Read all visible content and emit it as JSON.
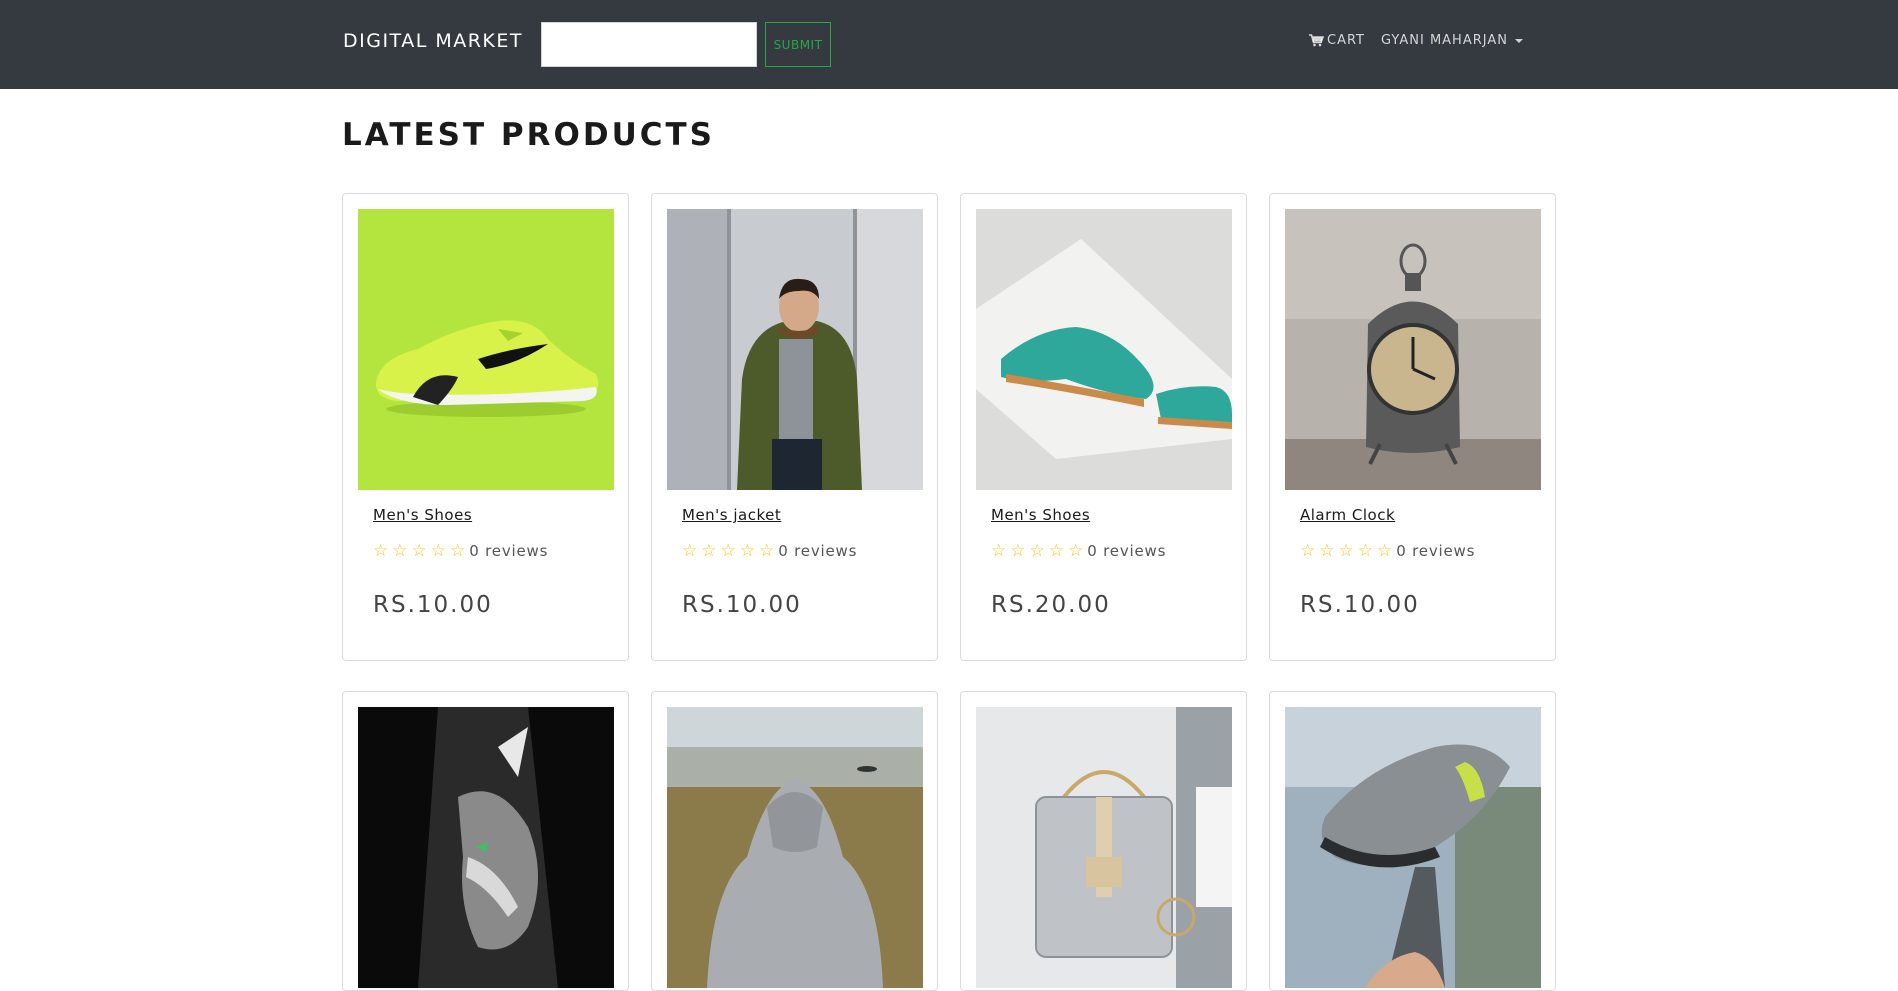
{
  "navbar": {
    "brand": "DIGITAL MARKET",
    "search_placeholder": "",
    "submit_label": "SUBMIT",
    "cart_label": "CART",
    "user_label": "GYANI MAHARJAN"
  },
  "main": {
    "title": "LATEST PRODUCTS",
    "products": [
      {
        "name": "Men's Shoes",
        "reviews": "0 reviews",
        "price": "RS.10.00",
        "image": "lime-sneaker"
      },
      {
        "name": "Men's jacket",
        "reviews": "0 reviews",
        "price": "RS.10.00",
        "image": "man-in-jacket"
      },
      {
        "name": "Men's Shoes",
        "reviews": "0 reviews",
        "price": "RS.20.00",
        "image": "teal-oxford-shoes"
      },
      {
        "name": "Alarm Clock",
        "reviews": "0 reviews",
        "price": "RS.10.00",
        "image": "alarm-clock"
      },
      {
        "name": "",
        "reviews": "",
        "price": "",
        "image": "dark-sneaker"
      },
      {
        "name": "",
        "reviews": "",
        "price": "",
        "image": "grey-hoodie"
      },
      {
        "name": "",
        "reviews": "",
        "price": "",
        "image": "handbag"
      },
      {
        "name": "",
        "reviews": "",
        "price": "",
        "image": "floating-sneaker"
      }
    ]
  },
  "colors": {
    "navbar_bg": "#343a40",
    "submit_green": "#28a745",
    "star_yellow": "#f0c419"
  }
}
